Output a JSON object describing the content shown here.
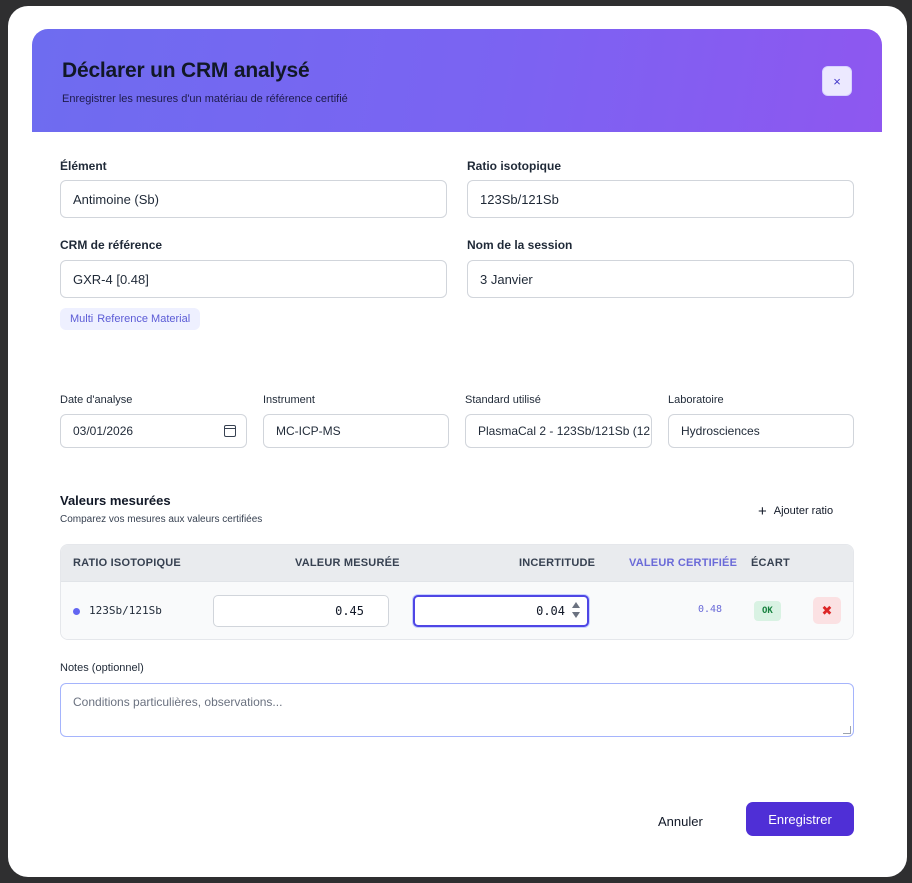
{
  "modal": {
    "title": "Déclarer un CRM analysé",
    "subtitle": "Enregistrer les mesures d'un matériau de référence certifié",
    "close_label": "×"
  },
  "form": {
    "element": {
      "label": "Élément",
      "value": "Antimoine (Sb)"
    },
    "ratio": {
      "label": "Ratio isotopique",
      "value": "123Sb/121Sb"
    },
    "crm": {
      "label": "CRM de référence",
      "value": "GXR-4 [0.48]"
    },
    "session": {
      "label": "Nom de la session",
      "value": "3 Janvier"
    },
    "chip": {
      "part1": "Multi",
      "part2": "Reference Material"
    },
    "date": {
      "label": "Date d'analyse",
      "value": "03/01/2026"
    },
    "instrument": {
      "label": "Instrument",
      "value": "MC-ICP-MS"
    },
    "standard": {
      "label": "Standard utilisé",
      "value": "PlasmaCal 2 - 123Sb/121Sb (12"
    },
    "laboratory": {
      "label": "Laboratoire",
      "value": "Hydrosciences"
    }
  },
  "measured": {
    "title": "Valeurs mesurées",
    "subtitle": "Comparez vos mesures aux valeurs certifiées",
    "add_ratio_label": "Ajouter ratio",
    "columns": [
      "RATIO ISOTOPIQUE",
      "VALEUR MESURÉE",
      "INCERTITUDE",
      "VALEUR CERTIFIÉE",
      "ÉCART"
    ],
    "rows": [
      {
        "ratio": "123Sb/121Sb",
        "measured": "0.45",
        "uncertainty": "0.04",
        "certified": "0.48",
        "deviation": "OK",
        "delete_label": "✖"
      }
    ]
  },
  "notes": {
    "label": "Notes (optionnel)",
    "placeholder": "Conditions particulières, observations..."
  },
  "footer": {
    "cancel_label": "Annuler",
    "save_label": "Enregistrer"
  },
  "colors": {
    "header_gradient_start": "#6e6cf0",
    "header_gradient_end": "#8e57f0",
    "primary": "#4f2fd6",
    "certified": "#6a6ad8",
    "ok": "#15803d",
    "danger": "#dc2626"
  }
}
